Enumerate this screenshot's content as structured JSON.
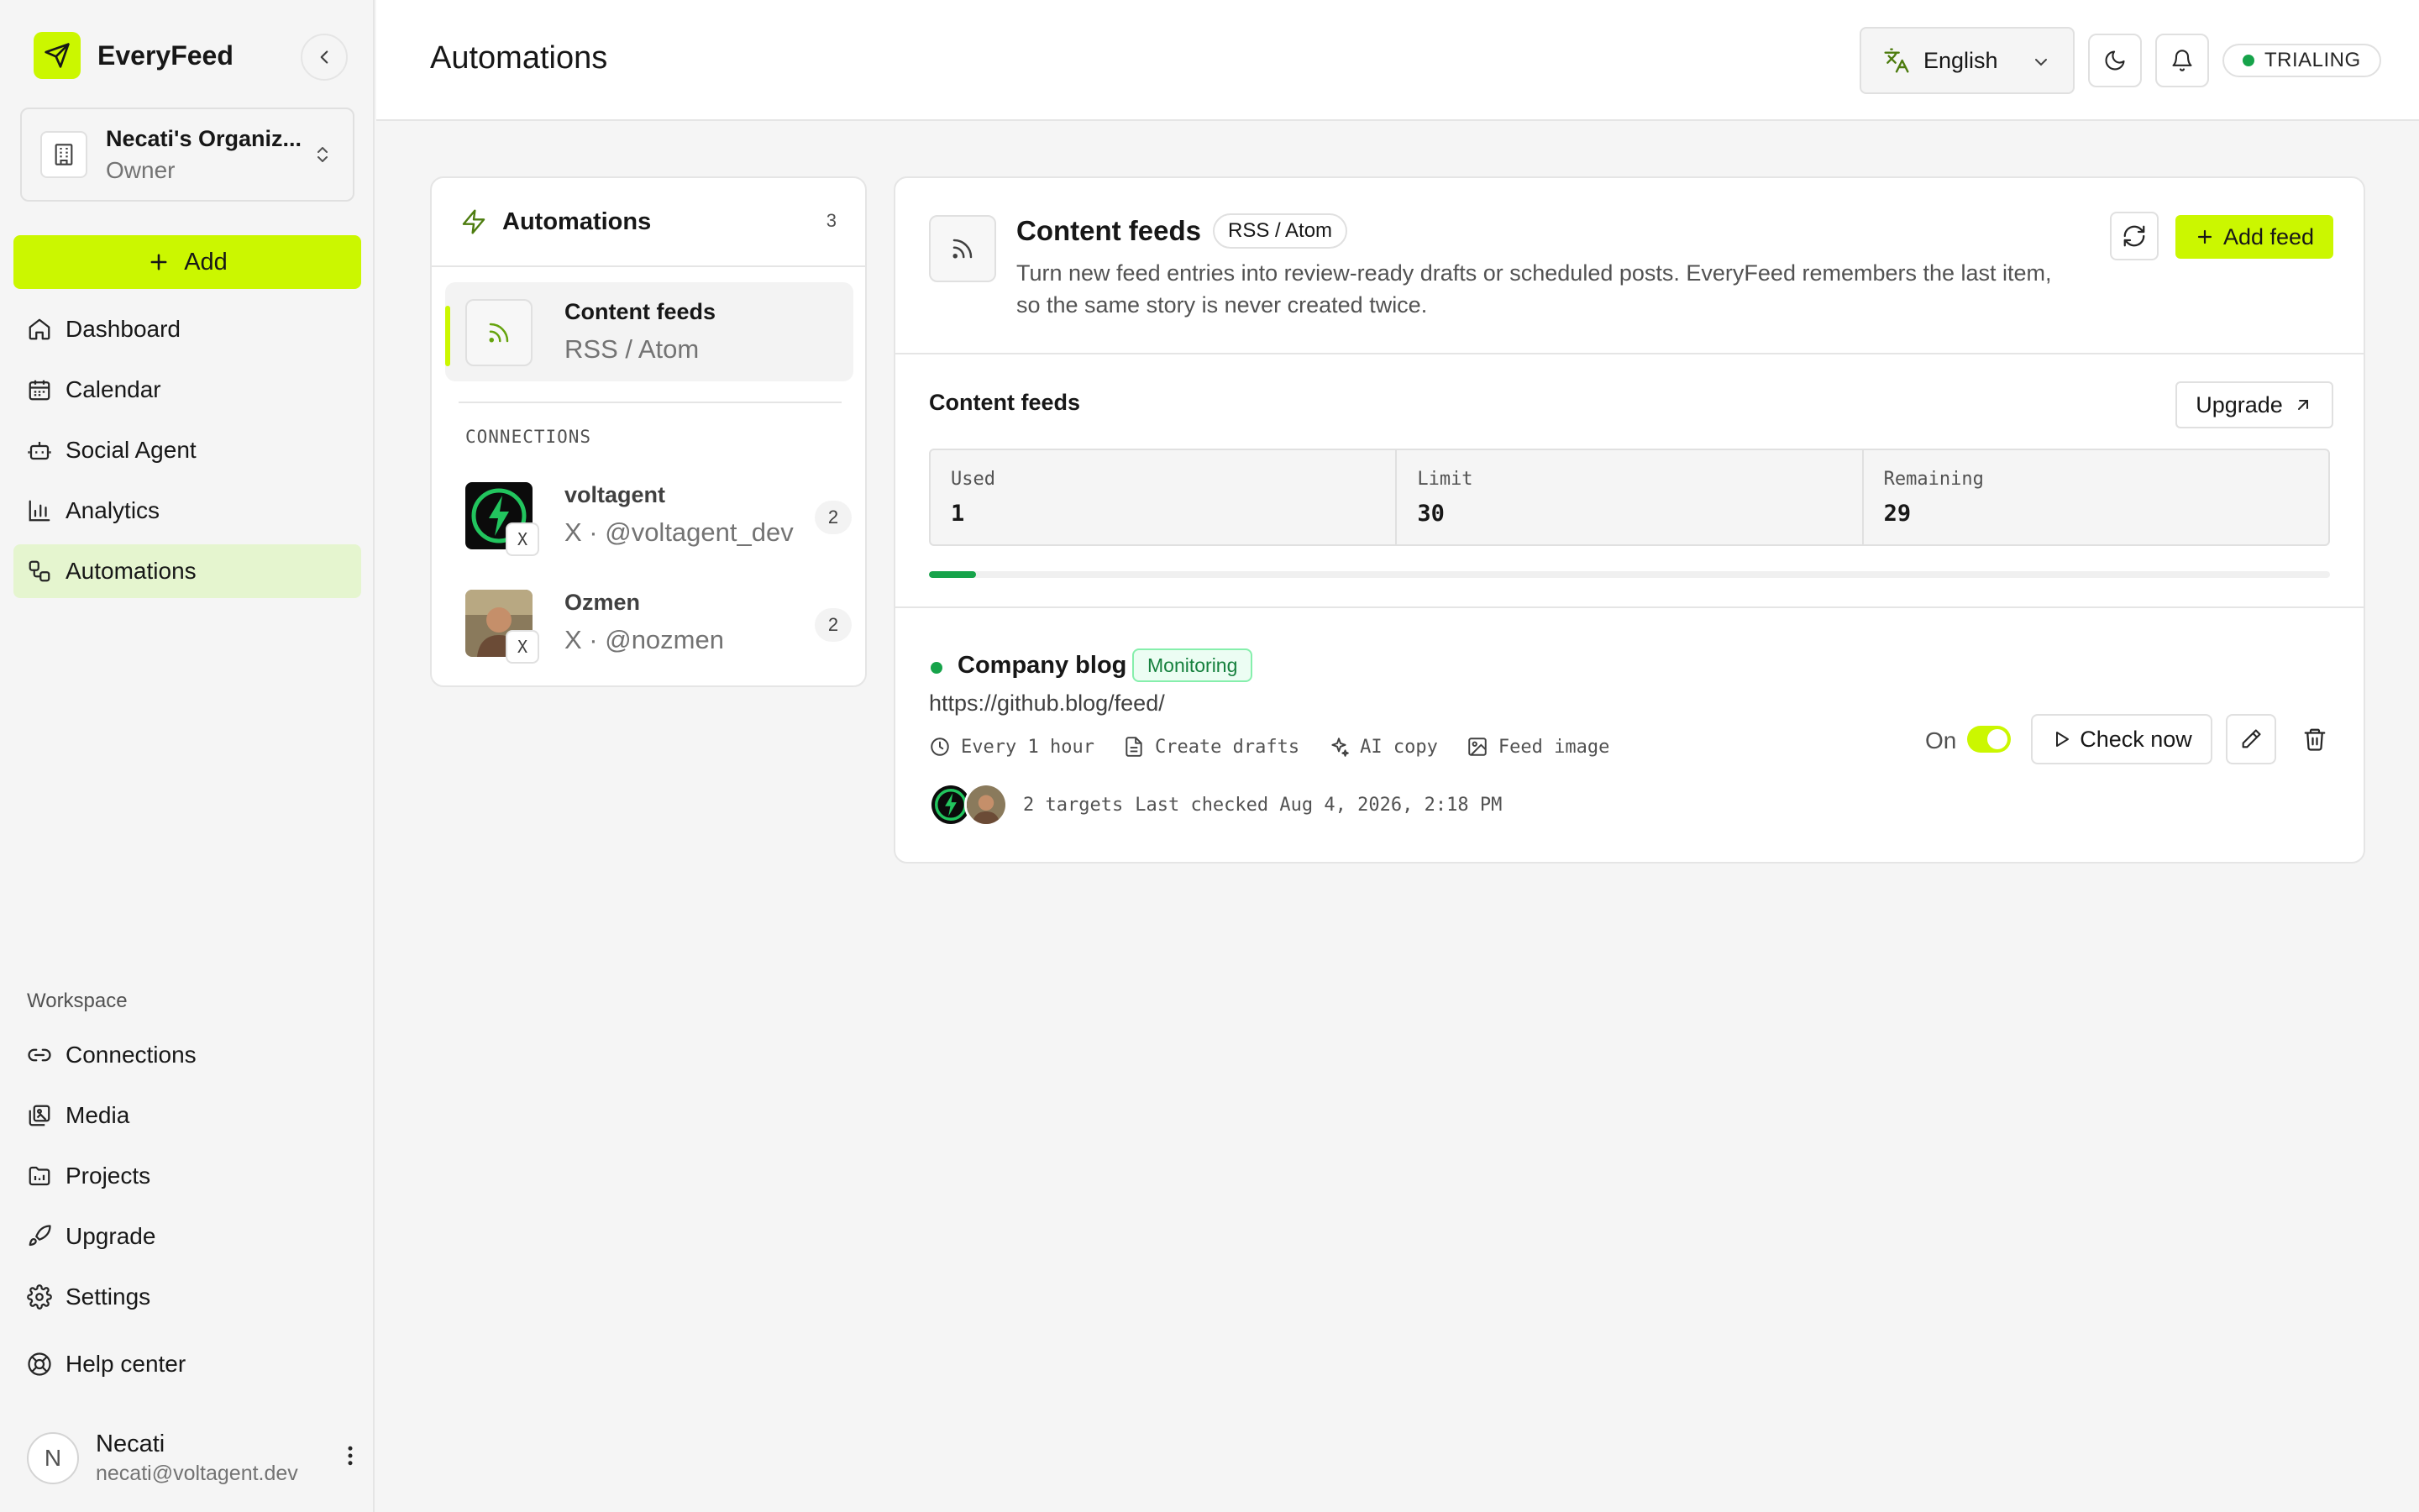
{
  "app": {
    "name": "EveryFeed"
  },
  "org": {
    "name": "Necati's Organiz...",
    "role": "Owner"
  },
  "sidebar": {
    "add_label": "Add",
    "main_items": [
      {
        "label": "Dashboard",
        "icon": "home-icon"
      },
      {
        "label": "Calendar",
        "icon": "calendar-icon"
      },
      {
        "label": "Social Agent",
        "icon": "bot-icon"
      },
      {
        "label": "Analytics",
        "icon": "bar-chart-icon"
      },
      {
        "label": "Automations",
        "icon": "workflow-icon",
        "active": true
      }
    ],
    "workspace_label": "Workspace",
    "workspace_items": [
      {
        "label": "Connections",
        "icon": "link-icon"
      },
      {
        "label": "Media",
        "icon": "images-icon"
      },
      {
        "label": "Projects",
        "icon": "folder-icon"
      },
      {
        "label": "Upgrade",
        "icon": "rocket-icon"
      },
      {
        "label": "Settings",
        "icon": "gear-icon"
      }
    ],
    "help_label": "Help center",
    "user": {
      "initial": "N",
      "name": "Necati",
      "email": "necati@voltagent.dev"
    }
  },
  "header": {
    "title": "Automations",
    "language": "English",
    "status": "TRIALING"
  },
  "automations_panel": {
    "title": "Automations",
    "count": "3",
    "feed_item": {
      "title": "Content feeds",
      "subtitle": "RSS / Atom"
    },
    "connections_label": "CONNECTIONS",
    "connections": [
      {
        "name": "voltagent",
        "handle": "X · @voltagent_dev",
        "count": "2",
        "network": "X"
      },
      {
        "name": "Ozmen",
        "handle": "X · @nozmen",
        "count": "2",
        "network": "X"
      }
    ]
  },
  "content_panel": {
    "title": "Content feeds",
    "badge": "RSS / Atom",
    "description": "Turn new feed entries into review-ready drafts or scheduled posts. EveryFeed remembers the last item, so the same story is never created twice.",
    "add_feed_label": "Add feed",
    "usage": {
      "title": "Content feeds",
      "upgrade_label": "Upgrade",
      "used_label": "Used",
      "used": "1",
      "limit_label": "Limit",
      "limit": "30",
      "remaining_label": "Remaining",
      "remaining": "29",
      "progress_fraction": 0.0333
    },
    "feed": {
      "name": "Company blog",
      "status": "Monitoring",
      "url": "https://github.blog/feed/",
      "meta": [
        {
          "label": "Every 1 hour",
          "icon": "clock-icon"
        },
        {
          "label": "Create drafts",
          "icon": "file-text-icon"
        },
        {
          "label": "AI copy",
          "icon": "sparkles-icon"
        },
        {
          "label": "Feed image",
          "icon": "image-icon"
        }
      ],
      "targets": "2 targets",
      "last_checked": "Last checked Aug 4, 2026, 2:18 PM",
      "toggle_label": "On",
      "toggle_on": true,
      "check_now_label": "Check now"
    }
  },
  "colors": {
    "accent": "#cbf700",
    "success": "#16a34a",
    "active_nav": "#e5f5cf"
  }
}
